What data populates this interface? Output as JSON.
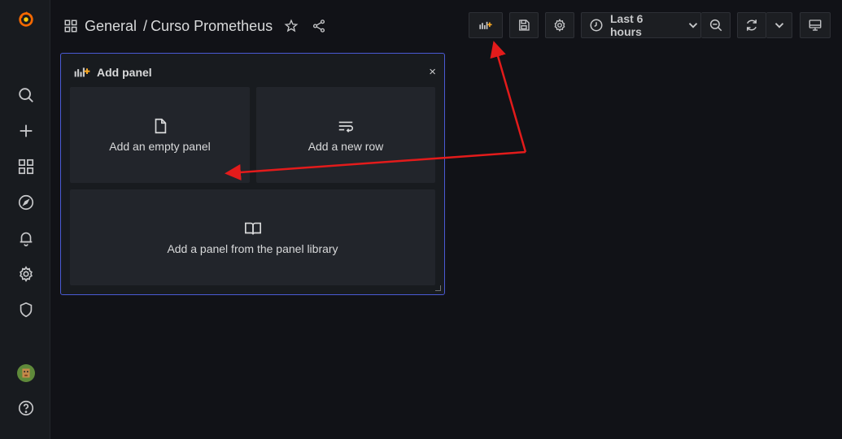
{
  "breadcrumb": {
    "folder": "General",
    "separator": "/",
    "dashboard": "Curso Prometheus"
  },
  "toolbar": {
    "time_range": "Last 6 hours"
  },
  "add_panel": {
    "title": "Add panel",
    "close": "×",
    "options": {
      "empty_panel": "Add an empty panel",
      "new_row": "Add a new row",
      "library": "Add a panel from the panel library"
    }
  },
  "colors": {
    "background": "#111217",
    "sidebar": "#181b1f",
    "card": "#22252b",
    "accent_border": "#4a5ad4",
    "annotation_arrow": "#e31b1b",
    "logo_orange": "#f46800"
  },
  "icons": {
    "sidebar": [
      "grafana-logo-icon",
      "search-icon",
      "plus-icon",
      "dashboards-icon",
      "explore-icon",
      "bell-icon",
      "gear-icon",
      "shield-icon",
      "avatar",
      "help-icon"
    ],
    "toolbar": [
      "add-panel-icon",
      "save-icon",
      "settings-icon",
      "clock-icon",
      "zoom-out-icon",
      "refresh-icon",
      "tv-icon"
    ]
  }
}
